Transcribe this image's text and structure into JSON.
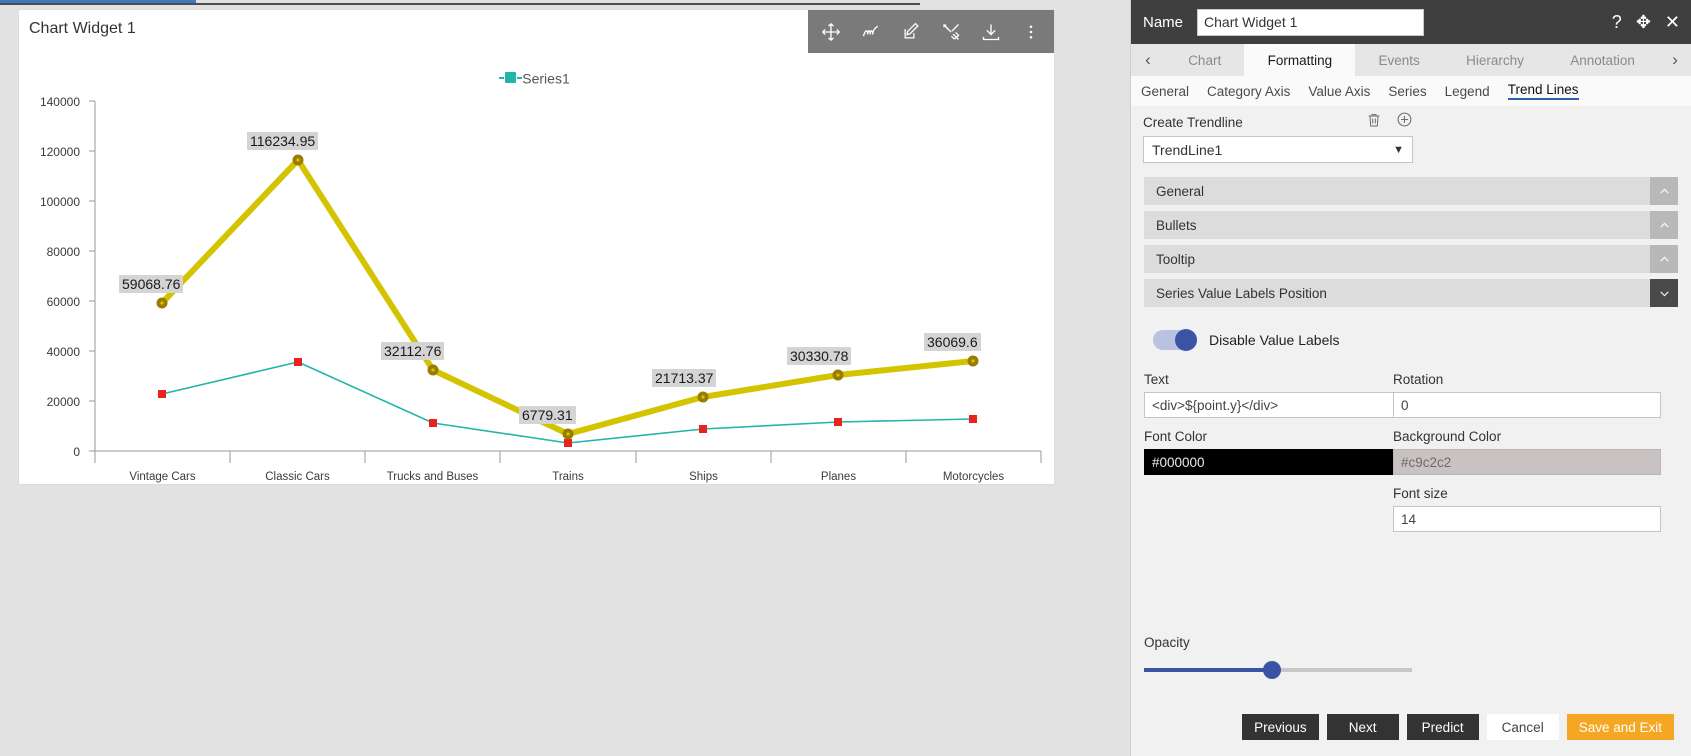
{
  "widget": {
    "title": "Chart Widget 1",
    "toolbar": [
      {
        "name": "move-icon",
        "label": "Move"
      },
      {
        "name": "scribble-icon",
        "label": "Annotate"
      },
      {
        "name": "edit-icon",
        "label": "Edit"
      },
      {
        "name": "tools-icon",
        "label": "Tools"
      },
      {
        "name": "download-icon",
        "label": "Download"
      },
      {
        "name": "more-vertical-icon",
        "label": "More"
      }
    ]
  },
  "chart_data": {
    "type": "line",
    "title": "",
    "xlabel": "",
    "ylabel": "",
    "grid": false,
    "legend_position": "top-center",
    "categories": [
      "Vintage Cars",
      "Classic Cars",
      "Trucks and Buses",
      "Trains",
      "Ships",
      "Planes",
      "Motorcycles"
    ],
    "yticks": [
      "0",
      "20000",
      "40000",
      "60000",
      "80000",
      "100000",
      "120000",
      "140000"
    ],
    "ylim": [
      0,
      140000
    ],
    "series": [
      {
        "name": "Series1",
        "color": "#23b5a8",
        "marker_color": "#e8231f",
        "marker": "square",
        "show_labels": false,
        "values": [
          22800,
          35500,
          11300,
          3200,
          8700,
          11800,
          12800
        ]
      },
      {
        "name": "TrendLine1",
        "color": "#d4c400",
        "marker_color": "#9a7d00",
        "marker": "circle",
        "show_labels": true,
        "values": [
          59068.76,
          116234.95,
          32112.76,
          6779.31,
          21713.37,
          30330.78,
          36069.6
        ],
        "labels": [
          "59068.76",
          "116234.95",
          "32112.76",
          "6779.31",
          "21713.37",
          "30330.78",
          "36069.6"
        ]
      }
    ]
  },
  "panel": {
    "name_label": "Name",
    "name_value": "Chart Widget 1",
    "header_icons": [
      {
        "name": "help-icon",
        "glyph": "?"
      },
      {
        "name": "move-icon",
        "glyph": "✥"
      },
      {
        "name": "close-icon",
        "glyph": "✕"
      }
    ],
    "tabs": [
      {
        "label": "Chart",
        "active": false
      },
      {
        "label": "Formatting",
        "active": true
      },
      {
        "label": "Events",
        "active": false
      },
      {
        "label": "Hierarchy",
        "active": false
      },
      {
        "label": "Annotation",
        "active": false
      }
    ],
    "tab_prev": "‹",
    "tab_next": "›",
    "subtabs": [
      {
        "label": "General",
        "active": false
      },
      {
        "label": "Category Axis",
        "active": false
      },
      {
        "label": "Value Axis",
        "active": false
      },
      {
        "label": "Series",
        "active": false
      },
      {
        "label": "Legend",
        "active": false
      },
      {
        "label": "Trend Lines",
        "active": true
      }
    ],
    "create_trendline_label": "Create Trendline",
    "delete_icon": "delete-icon",
    "add_icon": "add-circle-icon",
    "trendline_selected": "TrendLine1",
    "accordions": [
      {
        "title": "General",
        "expanded": true,
        "chevron": "⌃"
      },
      {
        "title": "Bullets",
        "expanded": true,
        "chevron": "⌃"
      },
      {
        "title": "Tooltip",
        "expanded": true,
        "chevron": "⌃"
      },
      {
        "title": "Series Value Labels Position",
        "expanded": false,
        "chevron": "⌄"
      }
    ],
    "toggle": {
      "label": "Disable Value Labels",
      "on": true
    },
    "fields": {
      "text_label": "Text",
      "text_value": "<div>${point.y}</div>",
      "rotation_label": "Rotation",
      "rotation_value": "0",
      "font_color_label": "Font Color",
      "font_color_value": "#000000",
      "background_color_label": "Background Color",
      "background_color_value": "#c9c2c2",
      "opacity_label": "Opacity",
      "opacity_percent": 45,
      "font_size_label": "Font size",
      "font_size_value": "14"
    },
    "footer_buttons": [
      {
        "label": "Previous",
        "style": "dark"
      },
      {
        "label": "Next",
        "style": "dark"
      },
      {
        "label": "Predict",
        "style": "dark"
      },
      {
        "label": "Cancel",
        "style": "plain"
      },
      {
        "label": "Save and Exit",
        "style": "accent"
      }
    ]
  }
}
